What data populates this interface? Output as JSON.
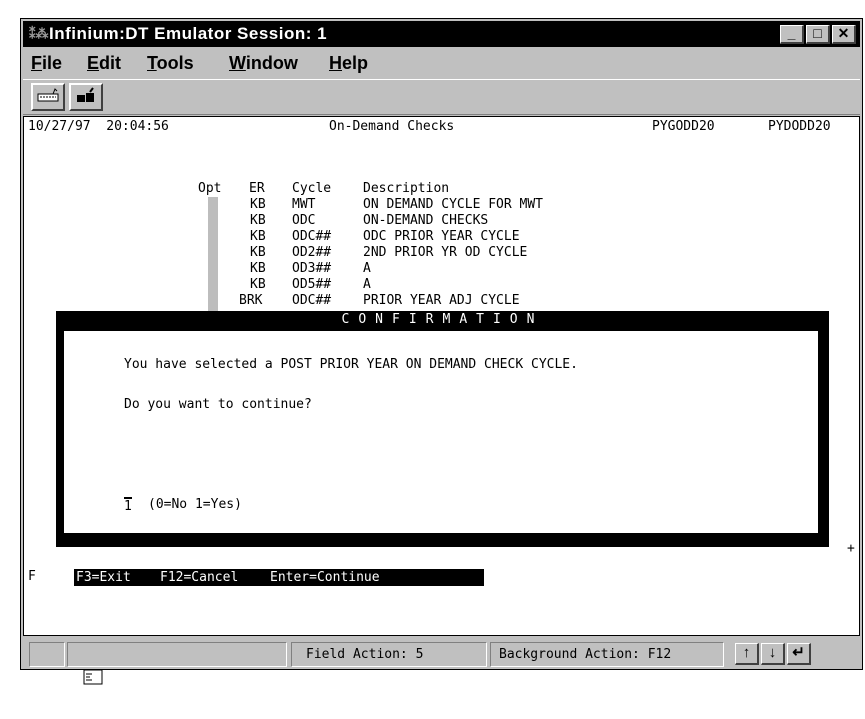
{
  "window": {
    "title": "Infinium:DT Emulator Session: 1",
    "minimize": "_",
    "maximize": "□",
    "close": "✕"
  },
  "menu": {
    "file": {
      "key": "F",
      "rest": "ile"
    },
    "edit": {
      "key": "E",
      "rest": "dit"
    },
    "tools": {
      "key": "T",
      "rest": "ools"
    },
    "window": {
      "key": "W",
      "rest": "indow"
    },
    "help": {
      "key": "H",
      "rest": "elp"
    }
  },
  "toolbar": {
    "icons": [
      "keyboard-icon",
      "connect-icon"
    ]
  },
  "screen": {
    "datetime": "10/27/97  20:04:56",
    "title": "On-Demand Checks",
    "program1": "PYGODD20",
    "program2": "PYDODD20",
    "headers": {
      "opt": "Opt",
      "er": "ER",
      "cycle": "Cycle",
      "description": "Description"
    },
    "rows": [
      {
        "er": "KB",
        "cycle": "MWT",
        "description": "ON DEMAND CYCLE FOR MWT"
      },
      {
        "er": "KB",
        "cycle": "ODC",
        "description": "ON-DEMAND CHECKS"
      },
      {
        "er": "KB",
        "cycle": "ODC##",
        "description": "ODC PRIOR YEAR CYCLE"
      },
      {
        "er": "KB",
        "cycle": "OD2##",
        "description": "2ND PRIOR YR OD CYCLE"
      },
      {
        "er": "KB",
        "cycle": "OD3##",
        "description": "A"
      },
      {
        "er": "KB",
        "cycle": "OD5##",
        "description": "A"
      },
      {
        "er": "BRK",
        "cycle": "ODC##",
        "description": "PRIOR YEAR ADJ CYCLE"
      }
    ],
    "left_f": "F",
    "plus": "+"
  },
  "dialog": {
    "title": "CONFIRMATION",
    "message": "You have selected a POST PRIOR YEAR ON DEMAND CHECK CYCLE.",
    "question": "Do you want to continue?",
    "input_value": "1",
    "input_hint": "(0=No 1=Yes)",
    "fkeys": {
      "exit": "F3=Exit",
      "cancel": "F12=Cancel",
      "continue": "Enter=Continue"
    }
  },
  "statusbar": {
    "field_action": "Field Action: 5",
    "background_action": "Background Action: F12",
    "up": "↑",
    "down": "↓",
    "enter": "↵"
  }
}
